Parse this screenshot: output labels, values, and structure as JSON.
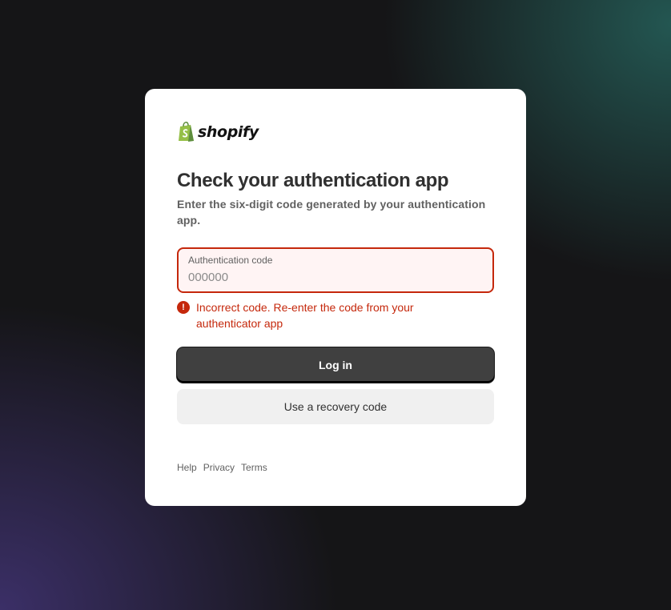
{
  "brand": {
    "name": "shopify",
    "icon": "shopify-bag-icon",
    "icon_color": "#95bf47"
  },
  "heading": "Check your authentication app",
  "subtitle": "Enter the six-digit code generated by your authentication app.",
  "auth_field": {
    "label": "Authentication code",
    "placeholder": "000000",
    "value": ""
  },
  "error": {
    "icon": "alert-circle-icon",
    "message": "Incorrect code. Re-enter the code from your authenticator app"
  },
  "buttons": {
    "login": "Log in",
    "recovery": "Use a recovery code"
  },
  "footer_links": [
    "Help",
    "Privacy",
    "Terms"
  ],
  "colors": {
    "error": "#c5280c",
    "primary_button": "#404040",
    "secondary_button": "#f0f0f0"
  }
}
